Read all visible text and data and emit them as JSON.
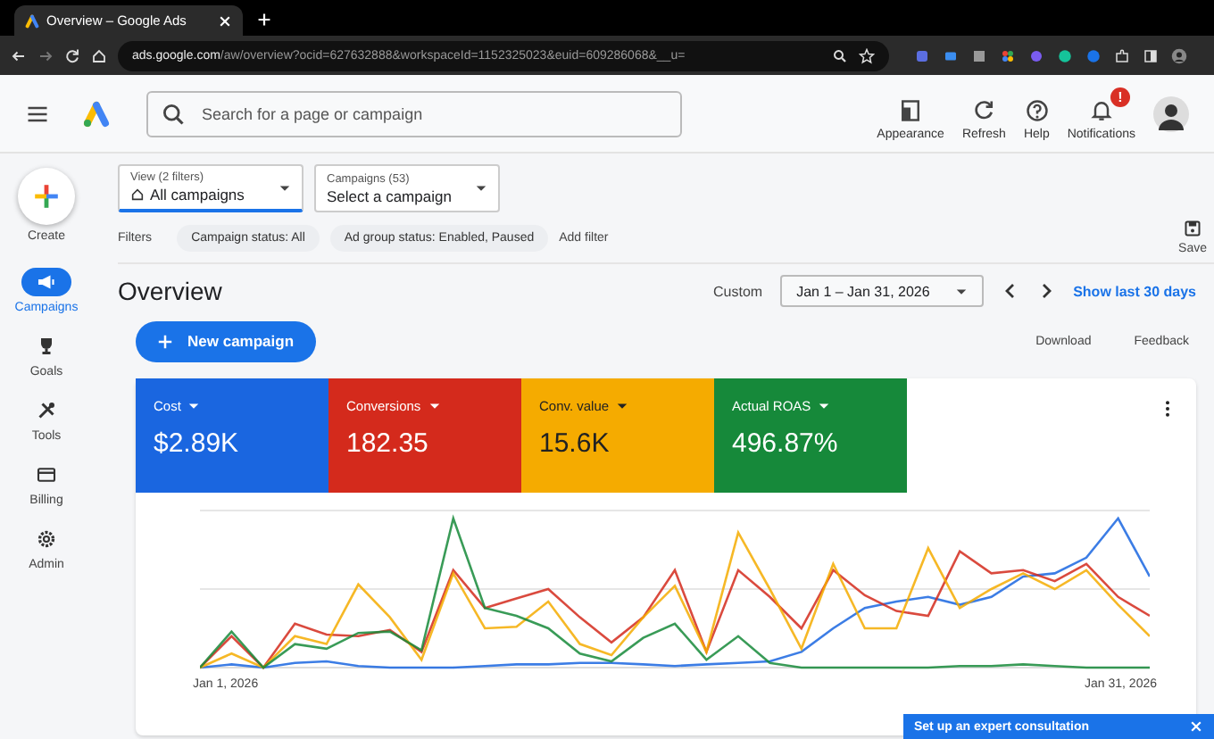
{
  "browser": {
    "tab_title": "Overview – Google Ads",
    "url_host": "ads.google.com",
    "url_path": "/aw/overview?ocid=627632888&workspaceId=1152325023&euid=609286068&__u="
  },
  "header": {
    "search": {
      "placeholder": "Search for a page or campaign"
    },
    "actions": [
      {
        "label": "Appearance",
        "kind": "appearance"
      },
      {
        "label": "Refresh",
        "kind": "refresh"
      },
      {
        "label": "Help",
        "kind": "help"
      },
      {
        "label": "Notifications",
        "kind": "notifications",
        "badge": "!"
      }
    ]
  },
  "sidebar": {
    "create": "Create",
    "items": [
      {
        "label": "Campaigns",
        "kind": "campaigns",
        "selected": true
      },
      {
        "label": "Goals",
        "kind": "goals",
        "selected": false
      },
      {
        "label": "Tools",
        "kind": "tools",
        "selected": false
      },
      {
        "label": "Billing",
        "kind": "billing",
        "selected": false
      },
      {
        "label": "Admin",
        "kind": "admin",
        "selected": false
      }
    ]
  },
  "selectors": [
    {
      "caption": "View (2 filters)",
      "value": "All campaigns",
      "selected": true
    },
    {
      "caption": "Campaigns (53)",
      "value": "Select a campaign",
      "selected": false
    }
  ],
  "filters": {
    "label": "Filters",
    "chips": [
      "Campaign status: All",
      "Ad group status: Enabled, Paused"
    ],
    "add": "Add filter",
    "save": "Save"
  },
  "overview": {
    "title": "Overview",
    "range_label": "Custom",
    "date_range": "Jan 1 – Jan 31, 2026",
    "show_last": "Show last 30 days",
    "new_campaign": "New campaign",
    "download": "Download",
    "feedback": "Feedback"
  },
  "metrics": [
    {
      "label": "Cost",
      "value": "$2.89K",
      "color": "#1a66e0"
    },
    {
      "label": "Conversions",
      "value": "182.35",
      "color": "#d42a1c"
    },
    {
      "label": "Conv. value",
      "value": "15.6K",
      "color": "#f5ab00"
    },
    {
      "label": "Actual ROAS",
      "value": "496.87%",
      "color": "#16893a"
    }
  ],
  "chart": {
    "x_start": "Jan 1, 2026",
    "x_end": "Jan 31, 2026"
  },
  "banner": {
    "text": "Set up an expert consultation"
  }
}
